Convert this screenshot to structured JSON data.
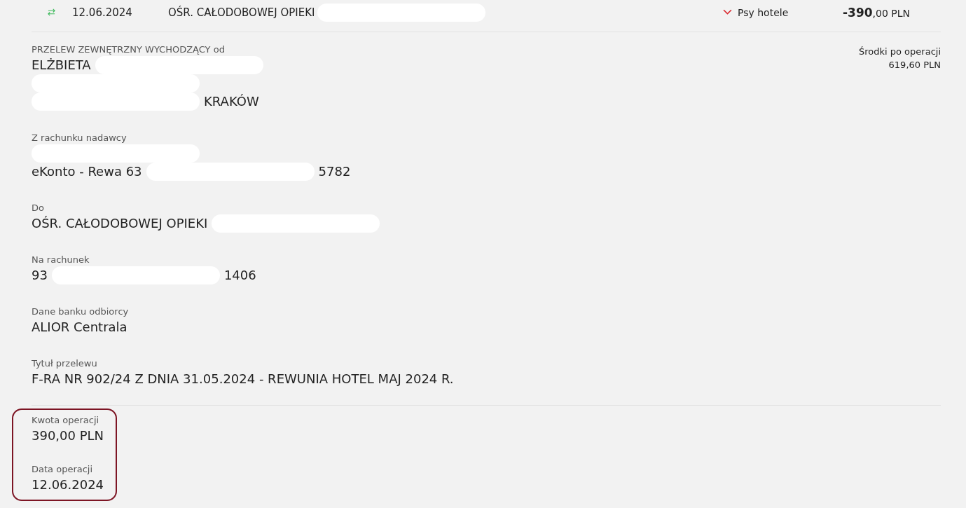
{
  "transaction": {
    "date": "12.06.2024",
    "recipient": [
      {
        "kind": "text",
        "text": "OŚR. CAŁODOBOWEJ OPIEKI"
      },
      {
        "kind": "redaction"
      }
    ],
    "category": "Psy hotele",
    "amount_main": "-390",
    "amount_rest": ",00 PLN"
  },
  "balance": {
    "label": "Środki po operacji",
    "value": "619,60 PLN"
  },
  "fields": [
    {
      "label": "PRZELEW ZEWNĘTRZNY WYCHODZĄCY od",
      "lines": [
        [
          {
            "kind": "text",
            "text": "ELŻBIETA"
          },
          {
            "kind": "redaction"
          }
        ],
        [
          {
            "kind": "redaction"
          }
        ],
        [
          {
            "kind": "redaction"
          },
          {
            "kind": "text",
            "text": "KRAKÓW"
          }
        ]
      ]
    },
    {
      "label": "Z rachunku nadawcy",
      "lines": [
        [
          {
            "kind": "redaction"
          }
        ],
        [
          {
            "kind": "text",
            "text": "eKonto - Rewa 63"
          },
          {
            "kind": "redaction"
          },
          {
            "kind": "text",
            "text": "5782"
          }
        ]
      ]
    },
    {
      "label": "Do",
      "lines": [
        [
          {
            "kind": "text",
            "text": "OŚR. CAŁODOBOWEJ OPIEKI"
          },
          {
            "kind": "redaction"
          }
        ]
      ]
    },
    {
      "label": "Na rachunek",
      "lines": [
        [
          {
            "kind": "text",
            "text": "93"
          },
          {
            "kind": "redaction"
          },
          {
            "kind": "text",
            "text": "1406"
          }
        ]
      ]
    },
    {
      "label": "Dane banku odbiorcy",
      "lines": [
        [
          {
            "kind": "text",
            "text": "ALIOR Centrala"
          }
        ]
      ]
    },
    {
      "label": "Tytuł przelewu",
      "lines": [
        [
          {
            "kind": "text",
            "text": "F-RA NR 902/24 Z DNIA 31.05.2024 - REWUNIA HOTEL MAJ 2024 R."
          }
        ]
      ]
    }
  ],
  "summary": [
    {
      "label": "Kwota operacji",
      "value": "390,00 PLN"
    },
    {
      "label": "Data operacji",
      "value": "12.06.2024"
    }
  ]
}
